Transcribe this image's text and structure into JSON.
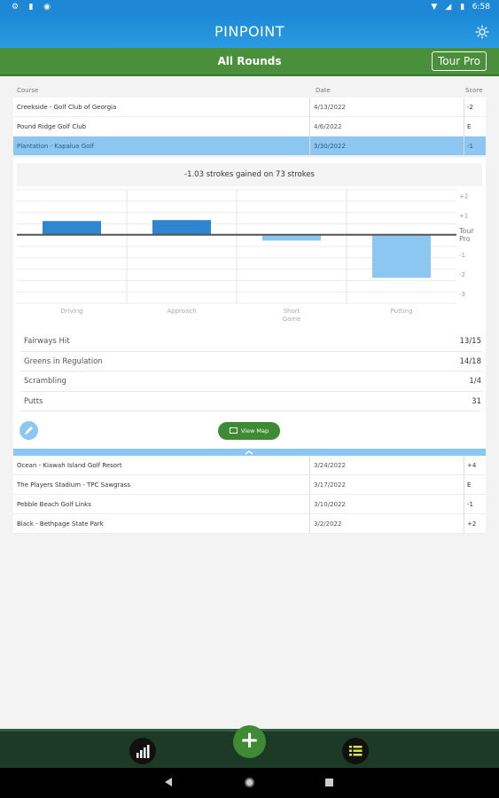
{
  "status_bar": {
    "time": "6:58",
    "left_icons": [
      "settings-icon",
      "sd-card-icon",
      "pocket-icon"
    ],
    "right_icons": [
      "wifi-icon",
      "signal-icon",
      "battery-icon"
    ]
  },
  "app": {
    "brand_left": "PIN",
    "brand_right": "POINT"
  },
  "title_bar": {
    "title": "All Rounds",
    "tour_pro_button": "Tour Pro"
  },
  "table": {
    "headers": {
      "course": "Course",
      "date": "Date",
      "score": "Score"
    },
    "rows_top": [
      {
        "course": "Creekside - Golf Club of Georgia",
        "date": "4/13/2022",
        "score": "-2"
      },
      {
        "course": "Pound Ridge Golf Club",
        "date": "4/6/2022",
        "score": "E"
      },
      {
        "course": "Plantation - Kapalua Golf",
        "date": "3/30/2022",
        "score": "-1"
      }
    ],
    "rows_bottom": [
      {
        "course": "Ocean - Kiawah Island Golf Resort",
        "date": "3/24/2022",
        "score": "+4"
      },
      {
        "course": "The Players Stadium - TPC Sawgrass",
        "date": "3/17/2022",
        "score": "E"
      },
      {
        "course": "Pebble Beach Golf Links",
        "date": "3/10/2022",
        "score": "-1"
      },
      {
        "course": "Black - Bethpage State Park",
        "date": "3/2/2022",
        "score": "+2"
      }
    ]
  },
  "detail": {
    "summary": "-1.03 strokes gained on 73 strokes",
    "view_map_label": "View Map",
    "stats": [
      {
        "label": "Fairways Hit",
        "value": "13/15"
      },
      {
        "label": "Greens in Regulation",
        "value": "14/18"
      },
      {
        "label": "Scrambling",
        "value": "1/4"
      },
      {
        "label": "Putts",
        "value": "31"
      }
    ]
  },
  "chart_data": {
    "type": "bar",
    "categories": [
      "Driving",
      "Approach",
      "Short Game",
      "Putting"
    ],
    "values": [
      0.7,
      0.75,
      -0.3,
      -2.2
    ],
    "baseline_label": "Tour Pro",
    "y_ticks": [
      "+2",
      "+1",
      "-1",
      "-2",
      "-3"
    ],
    "ylim": [
      -3.5,
      2.3
    ],
    "colors": {
      "positive": "#2f85cf",
      "negative": "#8cc7f2",
      "baseline": "#555555"
    }
  },
  "colors": {
    "app_bar": "#1e88d6",
    "title_bar": "#4a8f3b",
    "selected_row": "#8cc7f2",
    "bottom_bar": "#1d3a27",
    "accent_green": "#3f8a35"
  },
  "bottom_nav": {
    "icons": [
      "stats-icon",
      "add-round-icon",
      "list-icon"
    ]
  }
}
